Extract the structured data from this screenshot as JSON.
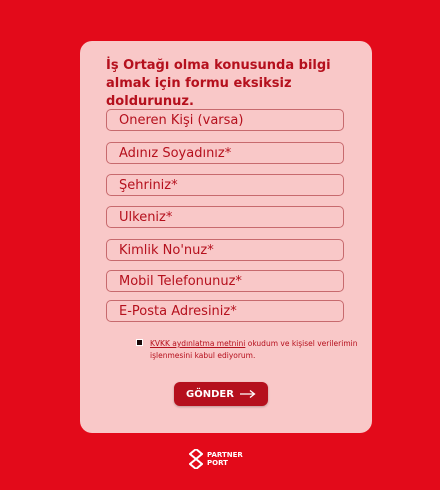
{
  "form": {
    "heading": "İş Ortağı olma konusunda bilgi almak için formu eksiksiz doldurunuz.",
    "fields": [
      {
        "placeholder": "Öneren Kişi (varsa)"
      },
      {
        "placeholder": "Adınız Soyadınız*"
      },
      {
        "placeholder": "Şehriniz*"
      },
      {
        "placeholder": "Ülkeniz*"
      },
      {
        "placeholder": "Kimlik No'nuz*"
      },
      {
        "placeholder": "Mobil Telefonunuz*"
      },
      {
        "placeholder": "E-Posta Adresiniz*"
      }
    ],
    "consent": {
      "link_text": "KVKK aydınlatma metnini",
      "text": " okudum ve kişisel verilerimin işlenmesini kabul ediyorum."
    },
    "submit_label": "GÖNDER"
  },
  "logo": {
    "line1": "PARTNER",
    "line2": "PORT"
  },
  "colors": {
    "background": "#e30a1a",
    "card": "#f9c8c8",
    "accent": "#b5101d"
  }
}
